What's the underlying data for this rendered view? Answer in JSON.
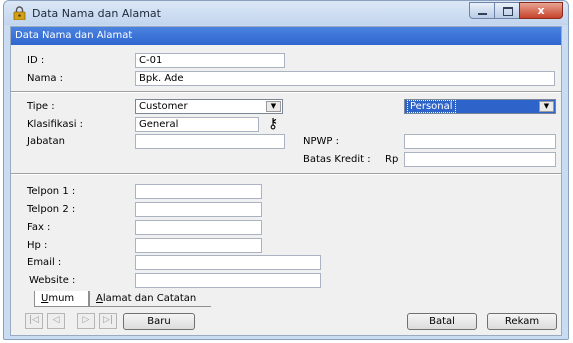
{
  "window": {
    "title": "Data Nama dan Alamat",
    "close_glyph": "x",
    "icons": {
      "title": "user-lock-icon",
      "minimize": "minimize-icon",
      "maximize": "maximize-icon",
      "close": "close-icon"
    }
  },
  "header": {
    "title": "Data Nama dan Alamat"
  },
  "form": {
    "id": {
      "label": "ID :",
      "value": "C-01"
    },
    "nama": {
      "label": "Nama :",
      "value": "Bpk. Ade"
    },
    "tipe": {
      "label": "Tipe :",
      "value": "Customer"
    },
    "kategori": {
      "value": "Personal"
    },
    "klasifikasi": {
      "label": "Klasifikasi :",
      "value": "General",
      "icon": "key-icon"
    },
    "jabatan": {
      "label": "Jabatan",
      "value": ""
    },
    "npwp": {
      "label": "NPWP :",
      "value": ""
    },
    "batas_kredit": {
      "label": "Batas Kredit :",
      "currency": "Rp",
      "value": ""
    },
    "telpon1": {
      "label": "Telpon 1 :",
      "value": ""
    },
    "telpon2": {
      "label": "Telpon 2 :",
      "value": ""
    },
    "fax": {
      "label": "Fax :",
      "value": ""
    },
    "hp": {
      "label": "Hp :",
      "value": ""
    },
    "email": {
      "label": "Email :",
      "value": ""
    },
    "website": {
      "label": "Website :",
      "value": ""
    }
  },
  "tabs": [
    {
      "first": "U",
      "rest": "mum",
      "active": true
    },
    {
      "first": "A",
      "rest": "lamat dan Catatan",
      "active": false
    }
  ],
  "navigation": {
    "first": "|◁",
    "prev": "◁",
    "next": "▷",
    "last": "▷|"
  },
  "buttons": {
    "baru": "Baru",
    "batal": "Batal",
    "rekam": "Rekam"
  },
  "colors": {
    "header_bar": "#2f66cf",
    "selection": "#2e64c9",
    "close_button": "#c7422a"
  }
}
